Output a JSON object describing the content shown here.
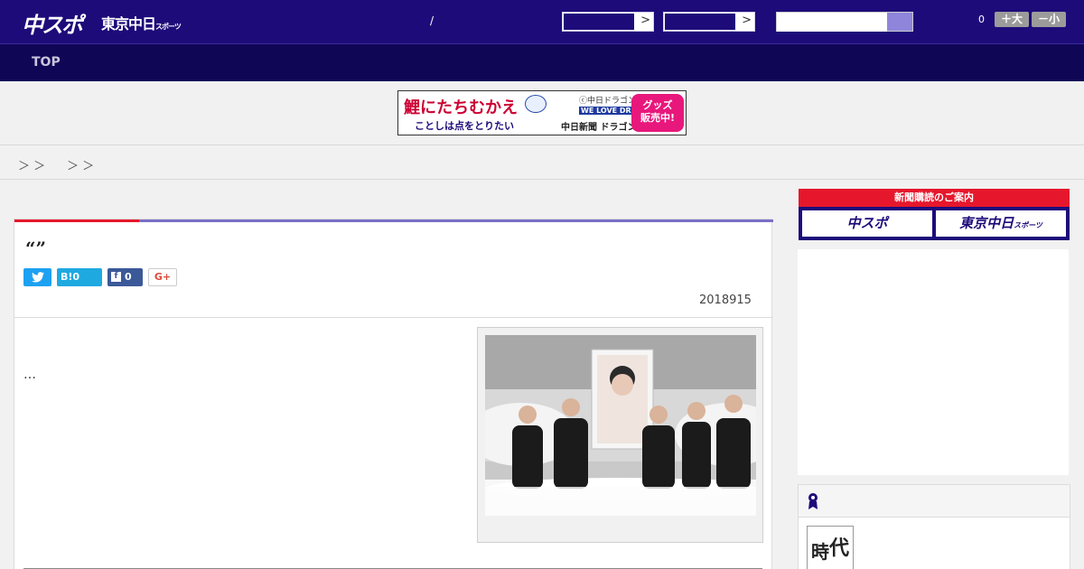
{
  "header": {
    "logo_chuspo": "中スポ",
    "logo_tokyo": "東京中日",
    "logo_tokyo_small": "スポーツ",
    "separator": "/",
    "select_arrow": ">",
    "notification_count": "0",
    "font_larger": "＋大",
    "font_smaller": "－小"
  },
  "nav": {
    "top_label": "TOP"
  },
  "banner": {
    "headline": "鯉にたちむかえ",
    "subline": "ことしは点をとりたい",
    "copyright": "ⓒ中日ドラゴンズ",
    "we_love": "WE LOVE DRAGONS",
    "shop": "中日新聞 ドラゴンズショップ",
    "goods_line1": "グッズ",
    "goods_line2": "販売中!"
  },
  "breadcrumb": {
    "seg1": "＞ ＞",
    "seg2": "＞ ＞"
  },
  "article": {
    "title": "“”",
    "share": {
      "twitter_icon": "twitter-icon",
      "hatena_label": "B!0",
      "facebook_count": "0",
      "gplus_label": "G+"
    },
    "date": "2018915",
    "lead": "…"
  },
  "sidebar": {
    "subscription_header": "新聞購読のご案内",
    "chuspo_button": "中スポ",
    "tokyo_button": "東京中日",
    "tokyo_button_small": "スポーツ",
    "thumb_text_1": "時",
    "thumb_text_2": "代"
  },
  "colors": {
    "header_bg": "#1e0b7a",
    "nav_bg": "#100656",
    "accent_red": "#e6172c",
    "accent_purple": "#7a6fc6"
  }
}
